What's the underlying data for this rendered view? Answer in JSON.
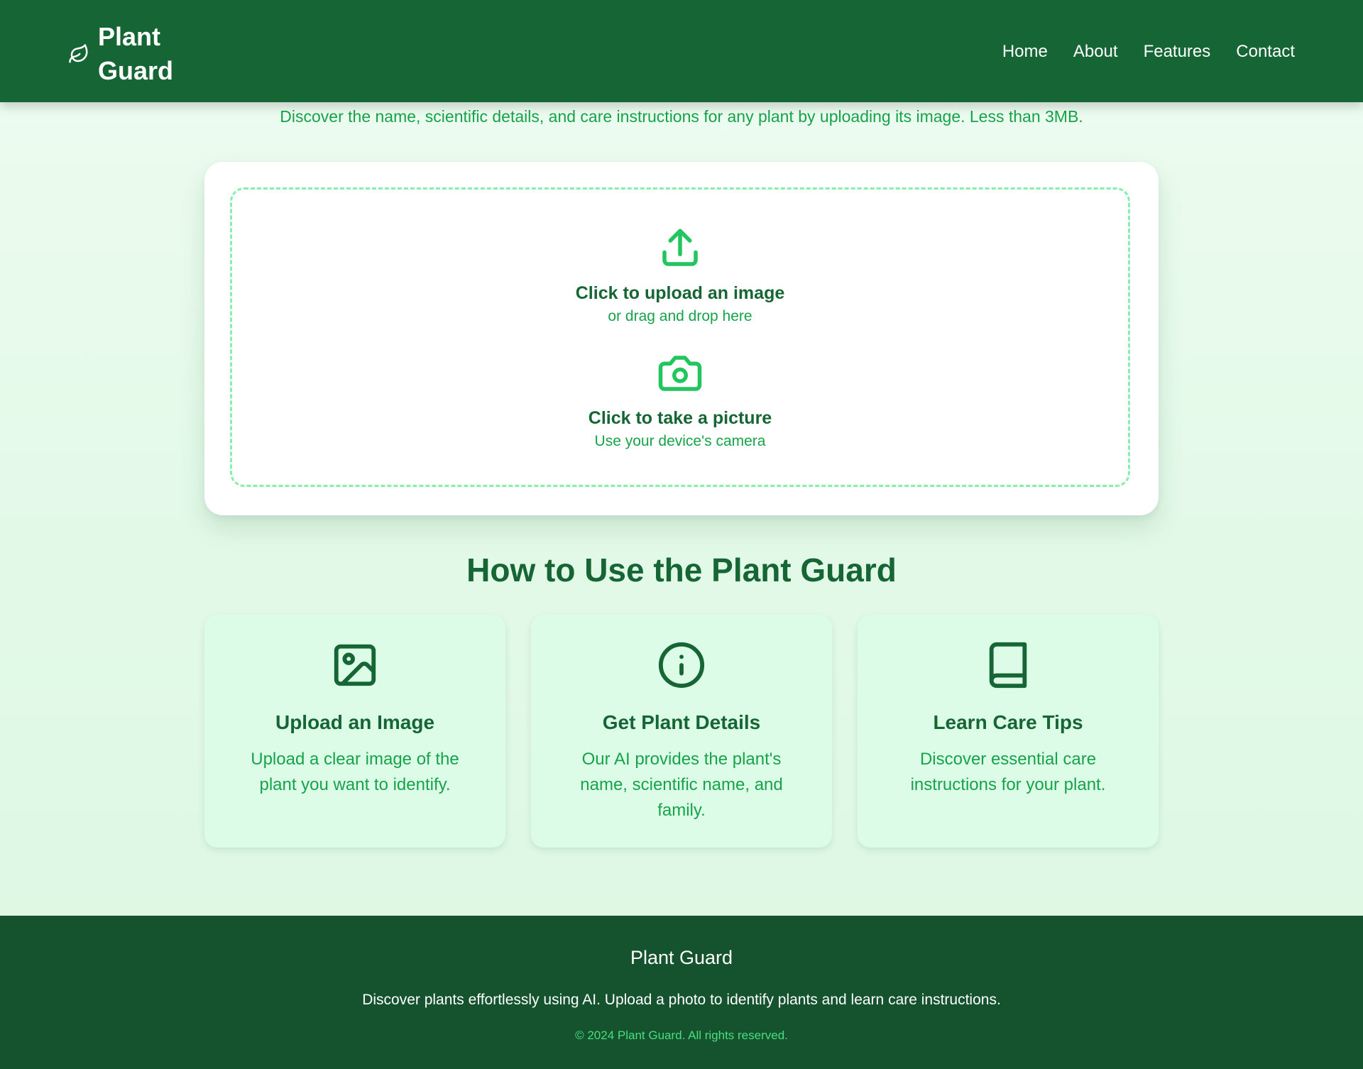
{
  "header": {
    "brand_line1": "Plant",
    "brand_line2": "Guard",
    "brand_icon": "leaf-icon",
    "nav": [
      "Home",
      "About",
      "Features",
      "Contact"
    ]
  },
  "subtitle": "Discover the name, scientific details, and care instructions for any plant by uploading its image. Less than 3MB.",
  "upload": {
    "upload_icon": "upload-icon",
    "upload_title": "Click to upload an image",
    "upload_sub": "or drag and drop here",
    "camera_icon": "camera-icon",
    "camera_title": "Click to take a picture",
    "camera_sub": "Use your device's camera"
  },
  "how": {
    "title": "How to Use the Plant Guard",
    "steps": [
      {
        "icon": "image-icon",
        "title": "Upload an Image",
        "desc": "Upload a clear image of the plant you want to identify."
      },
      {
        "icon": "info-icon",
        "title": "Get Plant Details",
        "desc": "Our AI provides the plant's name, scientific name, and family."
      },
      {
        "icon": "book-icon",
        "title": "Learn Care Tips",
        "desc": "Discover essential care instructions for your plant."
      }
    ]
  },
  "footer": {
    "title": "Plant Guard",
    "desc": "Discover plants effortlessly using AI. Upload a photo to identify plants and learn care instructions.",
    "copyright": "© 2024 Plant Guard. All rights reserved."
  },
  "colors": {
    "header_bg": "#166534",
    "footer_bg": "#14532d",
    "accent": "#22c55e",
    "dark_green": "#166534",
    "mid_green": "#16a34a",
    "card_bg": "#dcfce7"
  }
}
